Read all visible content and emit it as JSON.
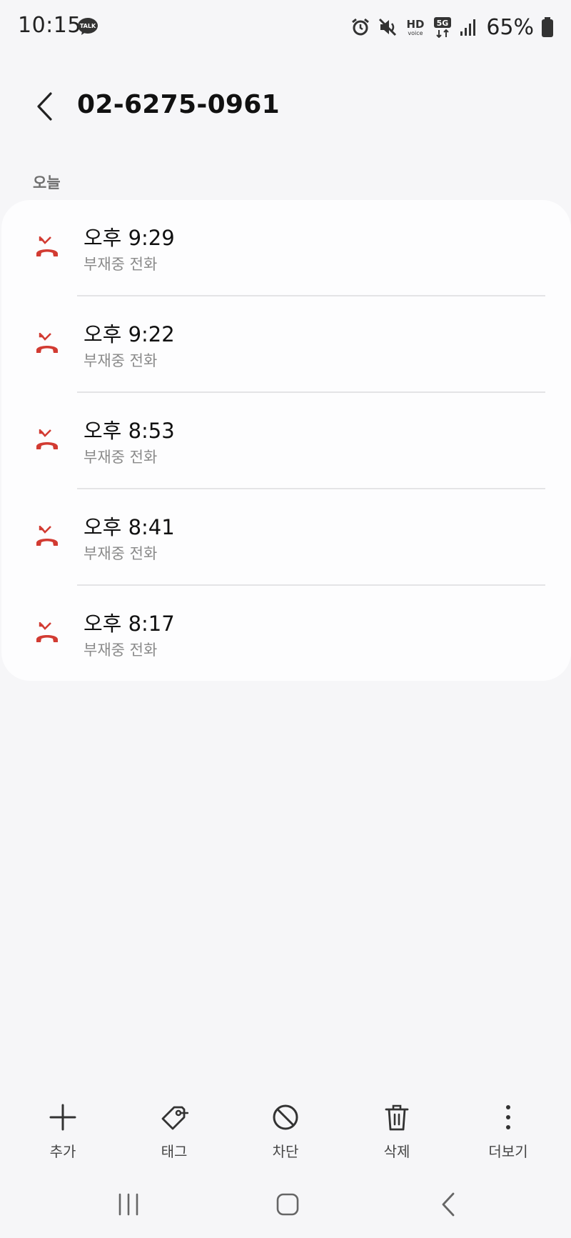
{
  "status_bar": {
    "time": "10:15",
    "notification_icon": "kakaotalk-icon",
    "notification_text": "TALK",
    "hd_text": "HD",
    "voice_text": "voice",
    "network_text": "5G",
    "battery_percent": "65%",
    "icons": [
      "alarm-icon",
      "mute-icon",
      "hd-voice-icon",
      "5g-icon",
      "signal-icon",
      "battery-icon"
    ]
  },
  "header": {
    "title": "02-6275-0961",
    "back_icon": "chevron-left-icon"
  },
  "section": {
    "label": "오늘"
  },
  "calls": [
    {
      "time": "오후 9:29",
      "type": "부재중 전화",
      "icon": "missed-call-icon"
    },
    {
      "time": "오후 9:22",
      "type": "부재중 전화",
      "icon": "missed-call-icon"
    },
    {
      "time": "오후 8:53",
      "type": "부재중 전화",
      "icon": "missed-call-icon"
    },
    {
      "time": "오후 8:41",
      "type": "부재중 전화",
      "icon": "missed-call-icon"
    },
    {
      "time": "오후 8:17",
      "type": "부재중 전화",
      "icon": "missed-call-icon"
    }
  ],
  "toolbar": {
    "add_label": "추가",
    "tag_label": "태그",
    "block_label": "차단",
    "delete_label": "삭제",
    "more_label": "더보기"
  },
  "colors": {
    "background": "#f6f6f8",
    "card": "#fdfdfe",
    "missed_red": "#d23b32",
    "secondary_text": "#8a8a8a"
  }
}
